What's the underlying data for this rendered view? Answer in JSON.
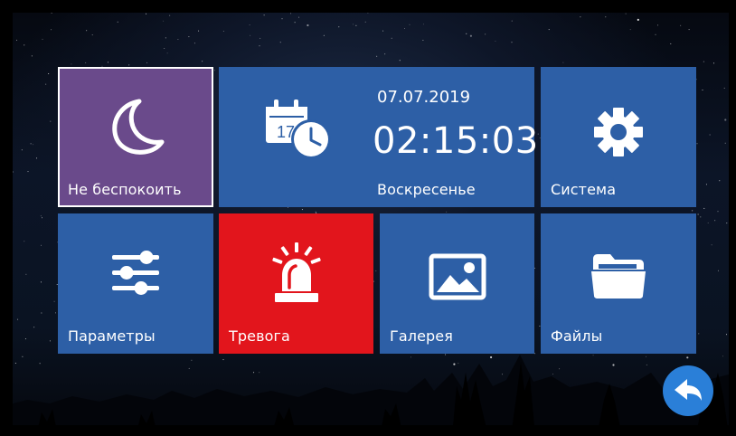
{
  "colors": {
    "tile_blue": "#2d5fa6",
    "tile_purple": "#6a4a8b",
    "tile_red": "#e2151c",
    "back_button": "#2a7fd8"
  },
  "tiles": {
    "do_not_disturb": {
      "label": "Не беспокоить",
      "icon": "moon-icon"
    },
    "clock": {
      "date": "07.07.2019",
      "time": "02:15:03",
      "weekday": "Воскресенье",
      "icon": "calendar-clock-icon",
      "calendar_day": "17"
    },
    "system": {
      "label": "Система",
      "icon": "gear-icon"
    },
    "parameters": {
      "label": "Параметры",
      "icon": "sliders-icon"
    },
    "alarm": {
      "label": "Тревога",
      "icon": "siren-icon"
    },
    "gallery": {
      "label": "Галерея",
      "icon": "image-icon"
    },
    "files": {
      "label": "Файлы",
      "icon": "folder-icon"
    }
  },
  "back_button": {
    "icon": "back-arrow-icon"
  }
}
